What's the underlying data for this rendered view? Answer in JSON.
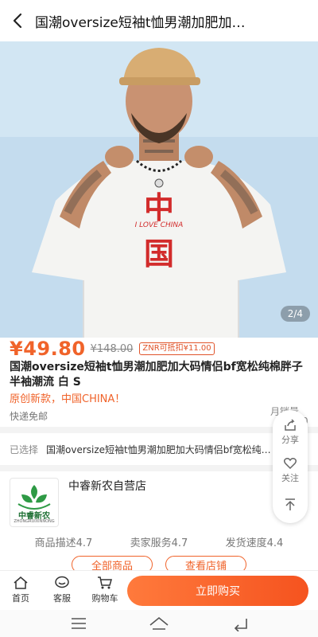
{
  "header": {
    "title": "国潮oversize短袖t恤男潮加肥加…"
  },
  "gallery": {
    "counter": "2/4",
    "shirt_text_top": "中",
    "shirt_text_mid": "I LOVE CHINA",
    "shirt_text_bottom": "国"
  },
  "product": {
    "price": "¥49.80",
    "original_price": "¥148.00",
    "coupon": "ZNR可抵扣¥11.00",
    "title": "国潮oversize短袖t恤男潮加肥加大码情侣bf宽松纯棉胖子半袖潮流 白 S",
    "promo": "原创新款，中国CHINA！",
    "shipping": "快递免邮",
    "monthly_sales_label": "月销量",
    "monthly_sales_value": "0"
  },
  "selected": {
    "label": "已选择",
    "value": "国潮oversize短袖t恤男潮加肥加大码情侣bf宽松纯…"
  },
  "side_panel": {
    "share": "分享",
    "follow": "关注"
  },
  "store": {
    "name": "中睿新农自营店",
    "logo_text": "中睿新农",
    "logo_subtext": "ZHONGRUIXINNONG",
    "ratings": [
      "商品描述4.7",
      "卖家服务4.7",
      "发货速度4.4"
    ],
    "all_products": "全部商品",
    "view_store": "查看店铺"
  },
  "bottom_bar": {
    "home": "首页",
    "service": "客服",
    "cart": "购物车",
    "buy": "立即购买"
  },
  "colors": {
    "accent": "#f0632a",
    "shirt_print": "#d22b2b"
  }
}
